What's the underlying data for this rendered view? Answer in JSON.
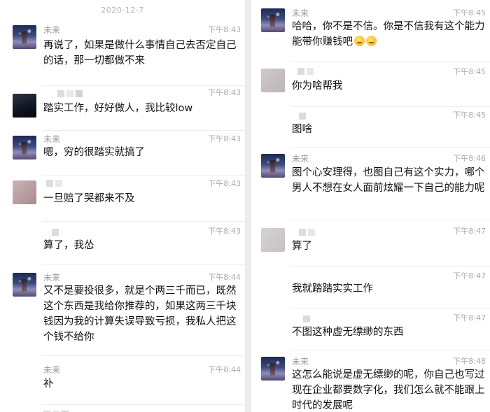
{
  "chat": {
    "date": "2020-12-7",
    "left": [
      {
        "name": "未来",
        "time": "下午8:43",
        "text": "再说了，如果是做什么事情自己去否定自己的话，那一切都做不来"
      },
      {
        "name": "",
        "time": "下午8:43",
        "text": "踏实工作，好好做人，我比较low"
      },
      {
        "name": "未来",
        "time": "下午8:43",
        "text": "嗯，穷的很踏实就搞了"
      },
      {
        "name": "",
        "time": "下午8:43",
        "text": "一旦赔了哭都来不及"
      },
      {
        "name": "",
        "time": "下午8:43",
        "text": "算了，我怂"
      },
      {
        "name": "未来",
        "time": "下午8:44",
        "text": "又不是要投很多，就是个两三千而已，既然这个东西是我给你推荐的，如果这两三千块钱因为我的计算失误导致亏损，我私人把这个钱不给你"
      },
      {
        "name": "未来",
        "time": "下午8:44",
        "text": "补"
      }
    ],
    "right": [
      {
        "name": "未来",
        "time": "下午8:45",
        "text": "哈哈，你不是不信。你是不信我有这个能力能带你赚钱吧"
      },
      {
        "name": "",
        "time": "下午8:45",
        "text": "你为啥帮我"
      },
      {
        "name": "",
        "time": "下午8:45",
        "text": "图啥"
      },
      {
        "name": "未来",
        "time": "下午8:46",
        "text": "图个心安理得，也图自己有这个实力，哪个男人不想在女人面前炫耀一下自己的能力呢"
      },
      {
        "name": "",
        "time": "下午8:47",
        "text": "算了"
      },
      {
        "name": "",
        "time": "下午8:47",
        "text": "我就踏踏实实工作"
      },
      {
        "name": "",
        "time": "下午8:47",
        "text": "不图这种虚无缥缈的东西"
      },
      {
        "name": "未来",
        "time": "下午8:48",
        "text": "这怎么能说是虚无缥缈的呢，你自己也写过现在企业都要数字化，我们怎么就不能跟上时代的发展呢"
      }
    ]
  }
}
